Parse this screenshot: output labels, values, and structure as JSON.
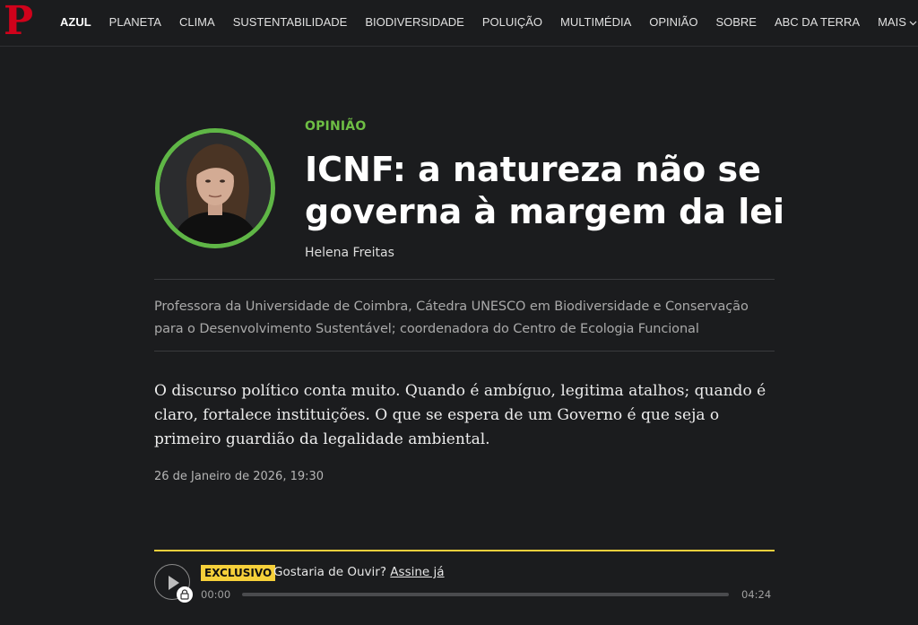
{
  "nav": {
    "logo": "P",
    "items": [
      {
        "label": "AZUL",
        "active": true
      },
      {
        "label": "PLANETA"
      },
      {
        "label": "CLIMA"
      },
      {
        "label": "SUSTENTABILIDADE"
      },
      {
        "label": "BIODIVERSIDADE"
      },
      {
        "label": "POLUIÇÃO"
      },
      {
        "label": "MULTIMÉDIA"
      },
      {
        "label": "OPINIÃO"
      },
      {
        "label": "SOBRE"
      },
      {
        "label": "ABC DA TERRA"
      },
      {
        "label": "MAIS"
      }
    ]
  },
  "article": {
    "kicker": "OPINIÃO",
    "title": "ICNF: a natureza não se governa à margem da lei",
    "author": "Helena Freitas",
    "author_bio": "Professora da Universidade de Coimbra, Cátedra UNESCO em Biodiversidade e Conservação para o Desenvolvimento Sustentável; coordenadora do Centro de Ecologia Funcional",
    "lead": "O discurso político conta muito. Quando é ambíguo, legitima atalhos; quando é claro, fortalece instituições. O que se espera de um Governo é que seja o primeiro guardião da legalidade ambiental.",
    "date": "26 de Janeiro de 2026, 19:30"
  },
  "player": {
    "badge": "EXCLUSIVO",
    "prompt": "Gostaria de Ouvir?",
    "link": "Assine já",
    "time_current": "00:00",
    "time_total": "04:24",
    "progress": 0
  },
  "colors": {
    "background": "#1b1c1e",
    "logo_red": "#d0021b",
    "accent_green": "#6ebe44",
    "accent_yellow": "#f6d03a"
  }
}
